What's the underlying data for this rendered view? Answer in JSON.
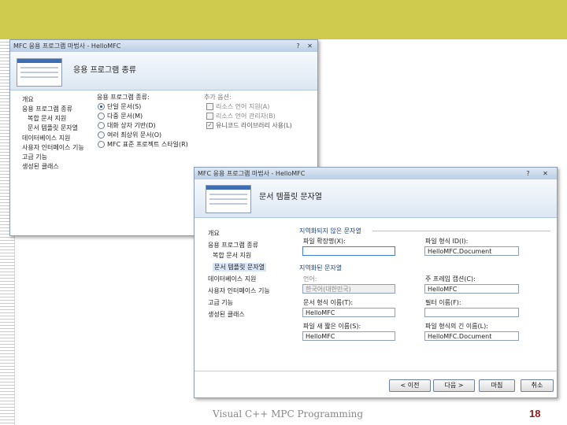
{
  "slide": {
    "footer_text": "Visual C++ MPC Programming",
    "page_number": "18",
    "colors": {
      "banner": "#cfcb4e",
      "accent": "#8b1a1a"
    }
  },
  "back_window": {
    "title": "MFC 응용 프로그램 마법사 - HelloMFC",
    "header": "응용 프로그램 종류",
    "nav": [
      "개요",
      "응용 프로그램 종류",
      "복합 문서 지원",
      "문서 템플릿 문자열",
      "데이터베이스 지원",
      "사용자 인터페이스 기능",
      "고급 기능",
      "생성된 클래스"
    ],
    "app_type_label": "응용 프로그램 종류:",
    "app_types": [
      "단일 문서(S)",
      "다중 문서(M)",
      "대화 상자 기반(D)",
      "여러 최상위 문서(O)",
      "MFC 표준 프로젝트 스타일(R)"
    ],
    "options_label": "추가 옵션:",
    "options": [
      "리소스 언어 지원(A)",
      "리소스 언어 관리자(B)",
      "유니코드 라이브러리 사용(L)"
    ]
  },
  "front_window": {
    "title": "MFC 응용 프로그램 마법사 - HelloMFC",
    "help_icon": "?",
    "header": "문서 템플릿 문자열",
    "nav": [
      "개요",
      "응용 프로그램 종류",
      "복합 문서 지원",
      "문서 템플릿 문자열",
      "데이터베이스 지원",
      "사용자 인터페이스 기능",
      "고급 기능",
      "생성된 클래스"
    ],
    "nonlocal_group": "지역화되지 않은 문자열",
    "localized_group": "지역화된 문자열",
    "fields": {
      "file_ext": {
        "label": "파일 확장명(X):",
        "value": ""
      },
      "file_type_id": {
        "label": "파일 형식 ID(I):",
        "value": "HelloMFC.Document"
      },
      "language": {
        "label": "언어:",
        "value": "한국어(대한민국)"
      },
      "main_frame_caption": {
        "label": "주 프레임 캡션(C):",
        "value": "HelloMFC"
      },
      "doc_type_name": {
        "label": "문서 형식 이름(T):",
        "value": "HelloMFC"
      },
      "filter_name": {
        "label": "필터 이름(F):",
        "value": ""
      },
      "file_new_short": {
        "label": "파일 새 짧은 이름(S):",
        "value": "HelloMFC"
      },
      "file_type_long": {
        "label": "파일 형식의 긴 이름(L):",
        "value": "HelloMFC.Document"
      }
    },
    "buttons": {
      "prev": "< 이전",
      "next": "다음 >",
      "finish": "마침",
      "cancel": "취소"
    }
  }
}
